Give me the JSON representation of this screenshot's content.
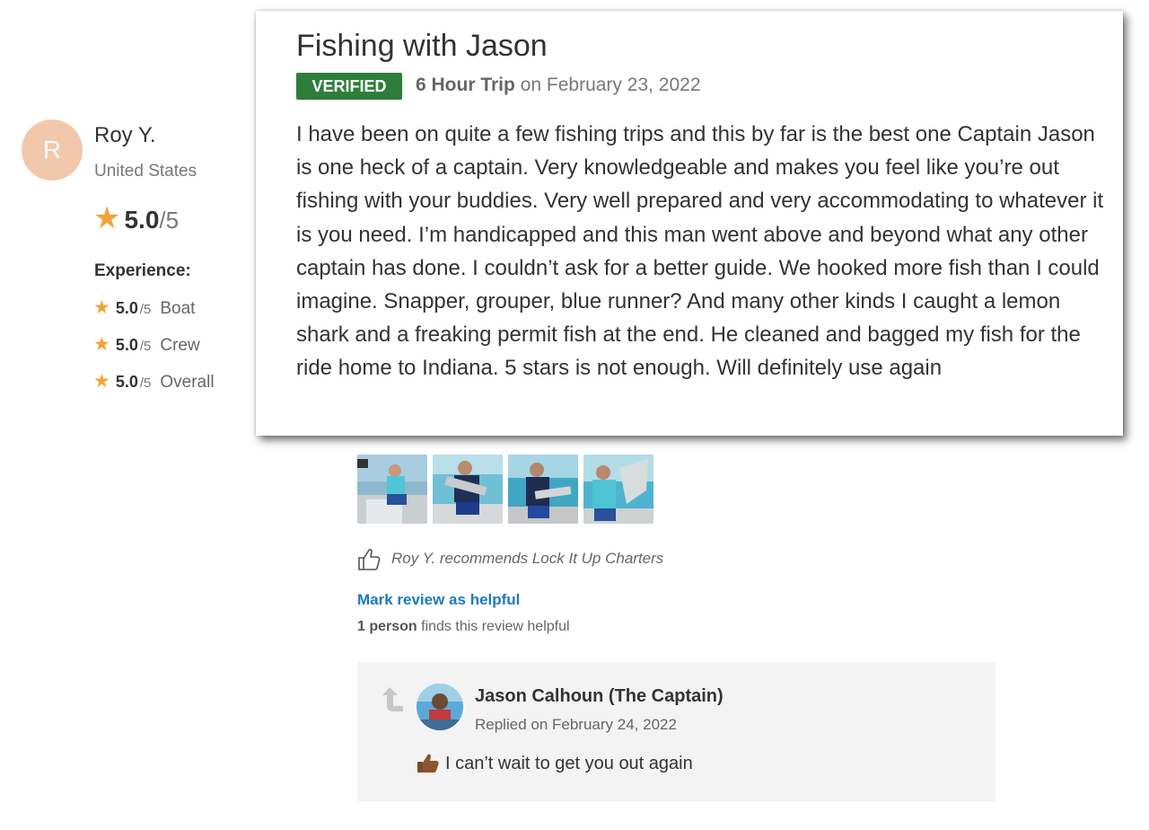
{
  "reviewer": {
    "initial": "R",
    "name": "Roy Y.",
    "country": "United States",
    "overall_score": "5.0",
    "overall_max": "/5",
    "experience_label": "Experience:",
    "experience": [
      {
        "score": "5.0",
        "max": "/5",
        "category": "Boat"
      },
      {
        "score": "5.0",
        "max": "/5",
        "category": "Crew"
      },
      {
        "score": "5.0",
        "max": "/5",
        "category": "Overall"
      }
    ],
    "avatar_color": "#f2c8ac",
    "star_color": "#f2a33a"
  },
  "review": {
    "title": "Fishing with Jason",
    "badge": "VERIFIED",
    "trip_type": "6 Hour Trip",
    "trip_date": "on February 23, 2022",
    "body": "I have been on quite a few fishing trips and this by far is the best one Captain Jason is one heck of a captain. Very knowledgeable and makes you feel like you’re out fishing with your buddies. Very well prepared and very accommodating to whatever it is you need. I’m handicapped and this man went above and beyond what any other captain has done. I couldn’t ask for a better guide. We hooked more fish than I could imagine. Snapper,  grouper, blue runner?  And many other kinds I caught a lemon shark and a freaking permit fish at the end. He cleaned and bagged my fish for the ride home to Indiana. 5 stars is not enough. Will definitely use again",
    "badge_color": "#2e7d3c"
  },
  "photo_count": 4,
  "recommendation": "Roy Y. recommends Lock It Up Charters",
  "helpful": {
    "link": "Mark review as helpful",
    "count_bold": "1 person",
    "count_text": " finds this review helpful",
    "link_color": "#1a7bbf"
  },
  "reply": {
    "name": "Jason Calhoun (The Captain)",
    "date": "Replied on February 24, 2022",
    "text": "I can’t wait to get you out again"
  }
}
